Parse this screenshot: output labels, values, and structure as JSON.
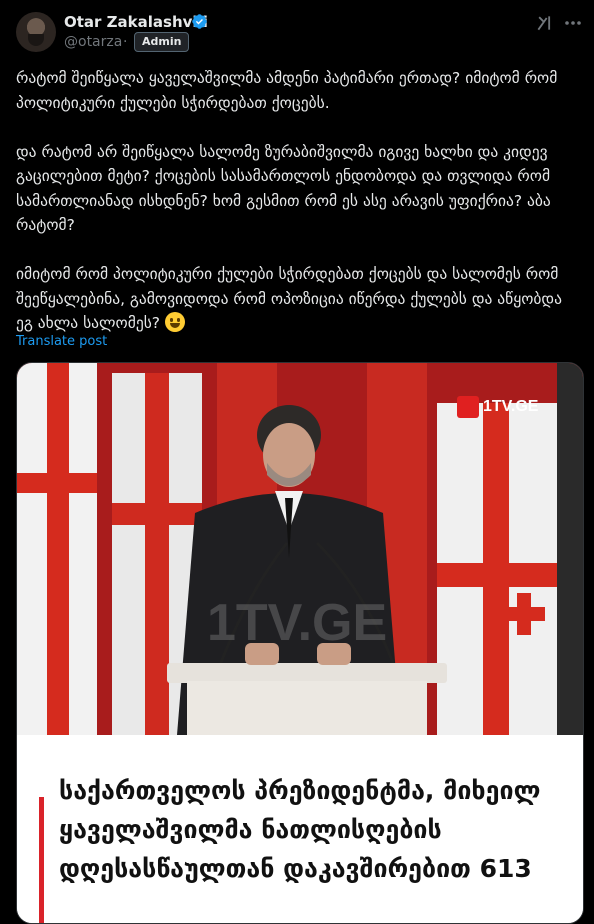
{
  "post": {
    "author": {
      "display_name": "Otar Zakalashvili",
      "handle": "@otarza",
      "separator": "·",
      "badge": "Admin"
    },
    "paragraphs": [
      "რატომ შეიწყალა ყაველაშვილმა ამდენი პატიმარი ერთად? იმიტომ რომ პოლიტიკური ქულები სჭირდებათ ქოცებს.",
      "და რატომ არ შეიწყალა სალომე ზურაბიშვილმა იგივე ხალხი და კიდევ გაცილებით მეტი? ქოცების სასამართლოს ენდობოდა და თვლიდა რომ სამართლიანად ისხდნენ? ხომ გესმით რომ ეს ასე არავის უფიქრია? აბა რატომ?",
      "იმიტომ რომ პოლიტიკური ქულები სჭირდებათ ქოცებს და სალომეს რომ შეეწყალებინა, გამოვიდოდა რომ ოპოზიცია იწერდა ქულებს და აწყობდა ეგ ახლა სალომეს?"
    ],
    "translate_label": "Translate post",
    "media": {
      "channel_logo": "1TV.GE",
      "watermark": "1TV.GE",
      "headline": "საქართველოს პრეზიდენტმა, მიხეილ ყაველაშვილმა ნათლისღების დღესასწაულთან დაკავშირებით 613"
    }
  },
  "icons": {
    "verified": "verified-badge-icon",
    "grok": "grok-icon",
    "more": "more-options-icon",
    "emoji": "grinning-face-emoji"
  },
  "colors": {
    "background": "#000000",
    "text": "#e7e9ea",
    "muted": "#71767b",
    "link": "#1d9bf0",
    "verified": "#1d9bf0",
    "accent_red": "#d9232a"
  }
}
